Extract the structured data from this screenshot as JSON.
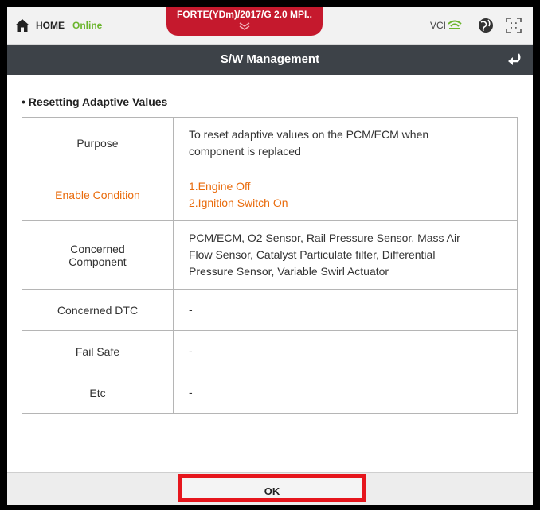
{
  "topbar": {
    "home_label": "HOME",
    "status": "Online",
    "vehicle": "FORTE(YDm)/2017/G 2.0 MPI..",
    "vci_label": "VCI",
    "status_color": "#6bb52d",
    "accent_color": "#c5192d"
  },
  "titlebar": {
    "title": "S/W Management"
  },
  "section": {
    "title": "• Resetting Adaptive Values"
  },
  "table": {
    "rows": [
      {
        "label": "Purpose",
        "value_lines": [
          "To reset adaptive values on the PCM/ECM when",
          "component is replaced"
        ]
      },
      {
        "label": "Enable Condition",
        "value_lines": [
          "1.Engine Off",
          "2.Ignition Switch On"
        ]
      },
      {
        "label_lines": [
          "Concerned",
          "Component"
        ],
        "value_lines": [
          "PCM/ECM, O2 Sensor, Rail Pressure Sensor, Mass Air",
          "Flow Sensor, Catalyst Particulate filter, Differential",
          "Pressure Sensor, Variable Swirl Actuator"
        ]
      },
      {
        "label": "Concerned DTC",
        "value_lines": [
          "-"
        ]
      },
      {
        "label": "Fail Safe",
        "value_lines": [
          "-"
        ]
      },
      {
        "label": "Etc",
        "value_lines": [
          "-"
        ]
      }
    ],
    "highlight_color": "#e96b0c"
  },
  "footer": {
    "ok_label": "OK"
  }
}
